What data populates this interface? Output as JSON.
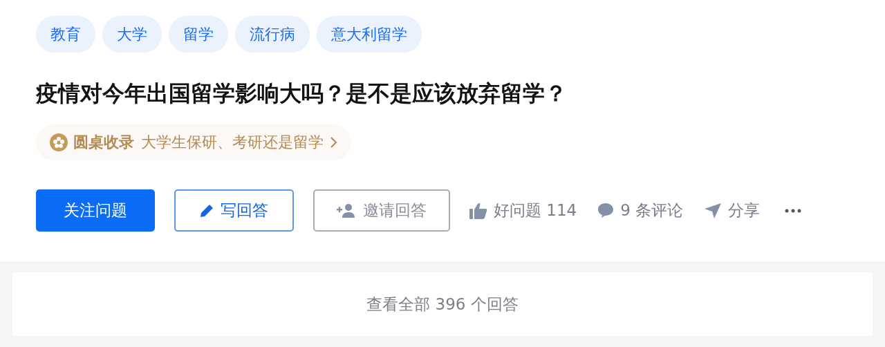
{
  "tags": [
    "教育",
    "大学",
    "留学",
    "流行病",
    "意大利留学"
  ],
  "title": "疫情对今年出国留学影响大吗？是不是应该放弃留学？",
  "roundtable": {
    "label": "圆桌收录",
    "name": "大学生保研、考研还是留学"
  },
  "buttons": [
    {
      "kind": "primary",
      "label": "关注问题"
    },
    {
      "kind": "outline",
      "label": "写回答"
    },
    {
      "kind": "secondary",
      "label": "邀请回答"
    }
  ],
  "actions": [
    {
      "kind": "like",
      "label": "好问题 114"
    },
    {
      "kind": "comment",
      "label": "9 条评论"
    },
    {
      "kind": "share",
      "label": "分享"
    },
    {
      "kind": "more"
    }
  ],
  "view_all": "查看全部 396 个回答"
}
